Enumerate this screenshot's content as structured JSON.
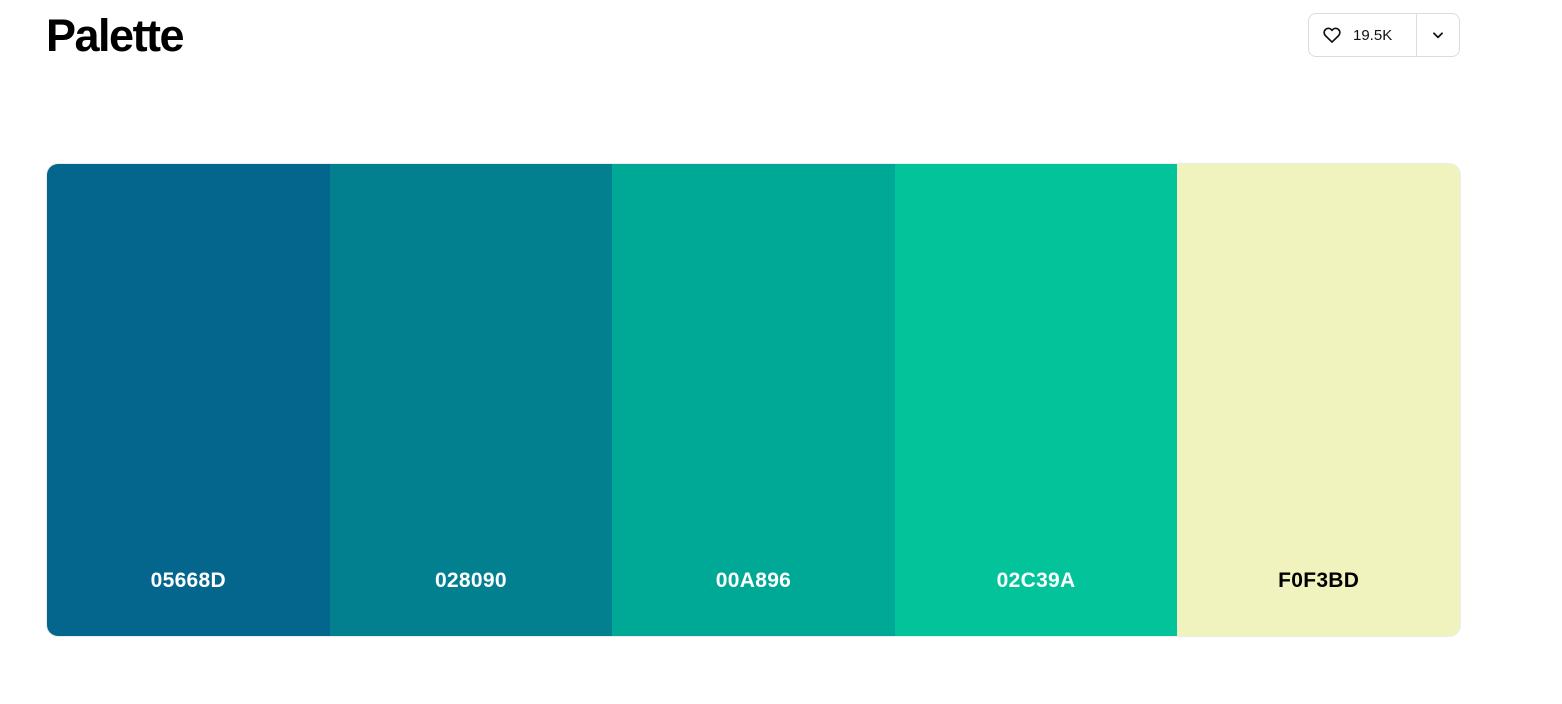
{
  "header": {
    "title": "Palette",
    "like_count": "19.5K"
  },
  "icons": {
    "like": "heart-icon",
    "menu": "chevron-down-icon"
  },
  "palette": {
    "colors": [
      {
        "hex": "05668D",
        "color": "#05668D",
        "text_color": "#FFFFFF"
      },
      {
        "hex": "028090",
        "color": "#028090",
        "text_color": "#FFFFFF"
      },
      {
        "hex": "00A896",
        "color": "#00A896",
        "text_color": "#FFFFFF"
      },
      {
        "hex": "02C39A",
        "color": "#02C39A",
        "text_color": "#FFFFFF"
      },
      {
        "hex": "F0F3BD",
        "color": "#F0F3BD",
        "text_color": "#000000"
      }
    ]
  }
}
